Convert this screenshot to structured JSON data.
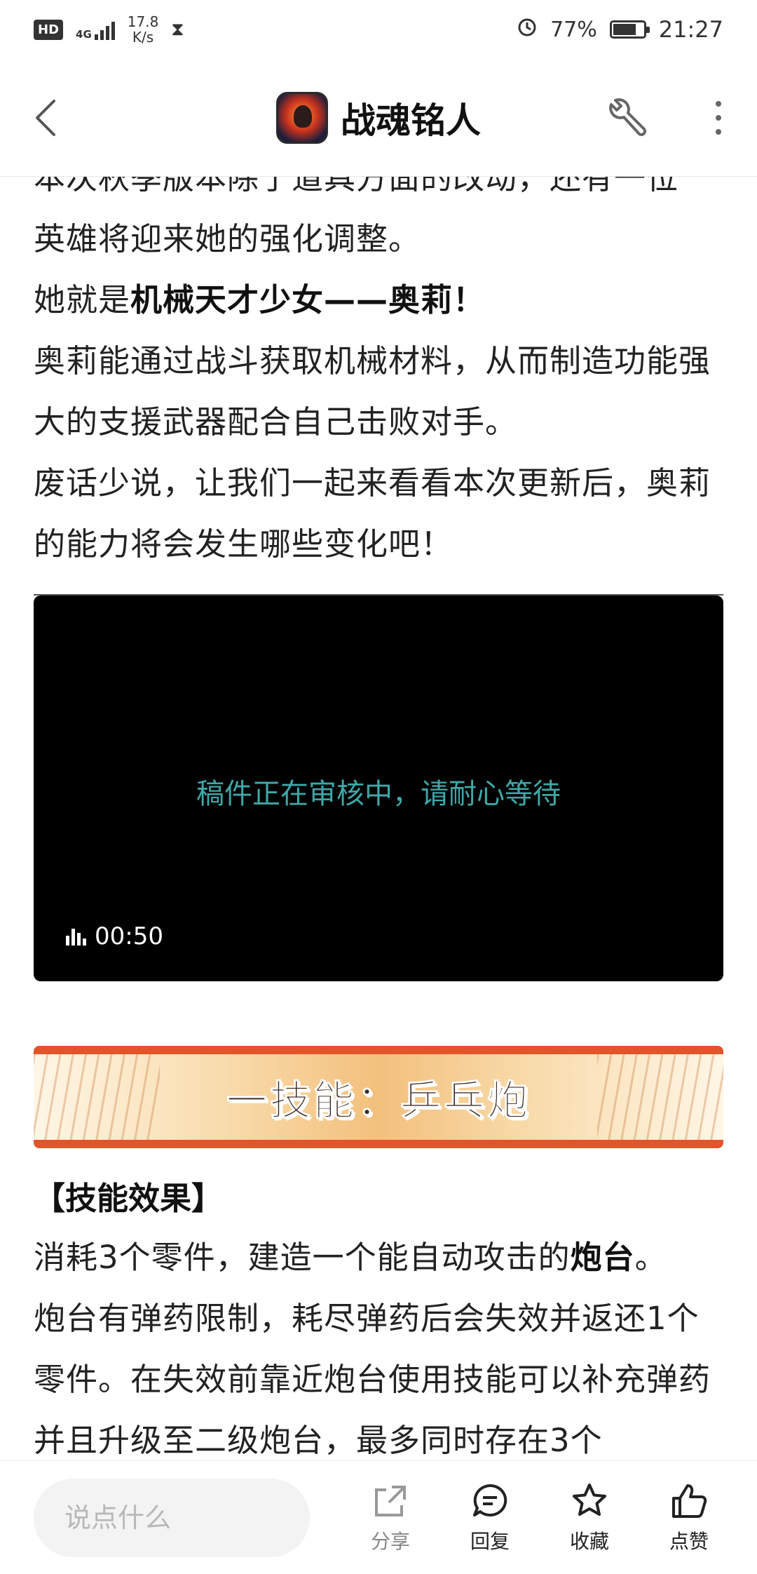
{
  "status_bar": {
    "hd": "HD",
    "network_label": "4G",
    "speed_value": "17.8",
    "speed_unit": "K/s",
    "battery": "77%",
    "battery_level": 0.77,
    "time": "21:27"
  },
  "header": {
    "title": "战魂铭人"
  },
  "article": {
    "cut_line": "本次秋季版本除了道具方面的改动，还有一位",
    "lines": [
      "英雄将迎来她的强化调整。"
    ],
    "intro_prefix": "她就是",
    "intro_bold": "机械天才少女——奥莉！",
    "para2": "奥莉能通过战斗获取机械材料，从而制造功能强大的支援武器配合自己击败对手。",
    "para3": "废话少说，让我们一起来看看本次更新后，奥莉的能力将会发生哪些变化吧！",
    "video": {
      "message": "稿件正在审核中，请耐心等待",
      "duration": "00:50"
    },
    "banner": "一技能：乒乓炮",
    "section_title": "【技能效果】",
    "skill_prefix": "消耗3个零件，建造一个能自动攻击的",
    "skill_bold": "炮台",
    "skill_suffix": "。",
    "skill_text": "炮台有弹药限制，耗尽弹药后会失效并返还1个零件。在失效前靠近炮台使用技能可以补充弹药并且升级至二级炮台，最多同时存在3个"
  },
  "bottom_bar": {
    "comment_placeholder": "说点什么",
    "share": "分享",
    "reply": "回复",
    "favorite": "收藏",
    "like": "点赞"
  }
}
